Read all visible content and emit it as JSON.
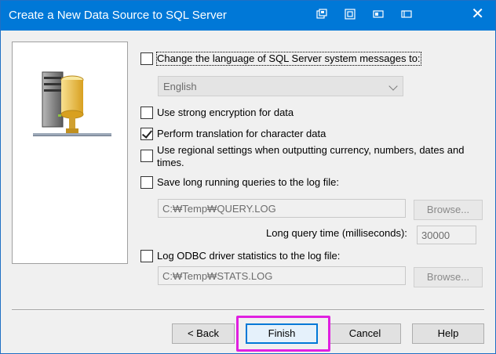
{
  "window": {
    "title": "Create a New Data Source to SQL Server",
    "close_glyph": "✕"
  },
  "options": {
    "change_language": {
      "label": "Change the language of SQL Server system messages to:",
      "checked": false
    },
    "language_value": "English",
    "strong_encryption": {
      "label": "Use strong encryption for data",
      "checked": false
    },
    "perform_translation": {
      "label": "Perform translation for character data",
      "checked": true
    },
    "regional_settings": {
      "label_line1": "Use regional settings when outputting currency, numbers, dates and",
      "label_line2": "times.",
      "checked": false
    },
    "save_long_queries": {
      "label": "Save long running queries to the log file:",
      "checked": false
    },
    "query_log_path": "C:₩Temp₩QUERY.LOG",
    "browse1_label": "Browse...",
    "long_query_time_label": "Long query time (milliseconds):",
    "long_query_time_value": "30000",
    "log_odbc_stats": {
      "label": "Log ODBC driver statistics to the log file:",
      "checked": false
    },
    "stats_log_path": "C:₩Temp₩STATS.LOG",
    "browse2_label": "Browse..."
  },
  "buttons": {
    "back": "< Back",
    "finish": "Finish",
    "cancel": "Cancel",
    "help": "Help"
  },
  "colors": {
    "titlebar": "#0078d7",
    "highlight": "#e020e0"
  },
  "icons": [
    "restore-icon",
    "maximize-icon",
    "tile-icon",
    "window-icon",
    "close-icon",
    "database-server-icon"
  ]
}
